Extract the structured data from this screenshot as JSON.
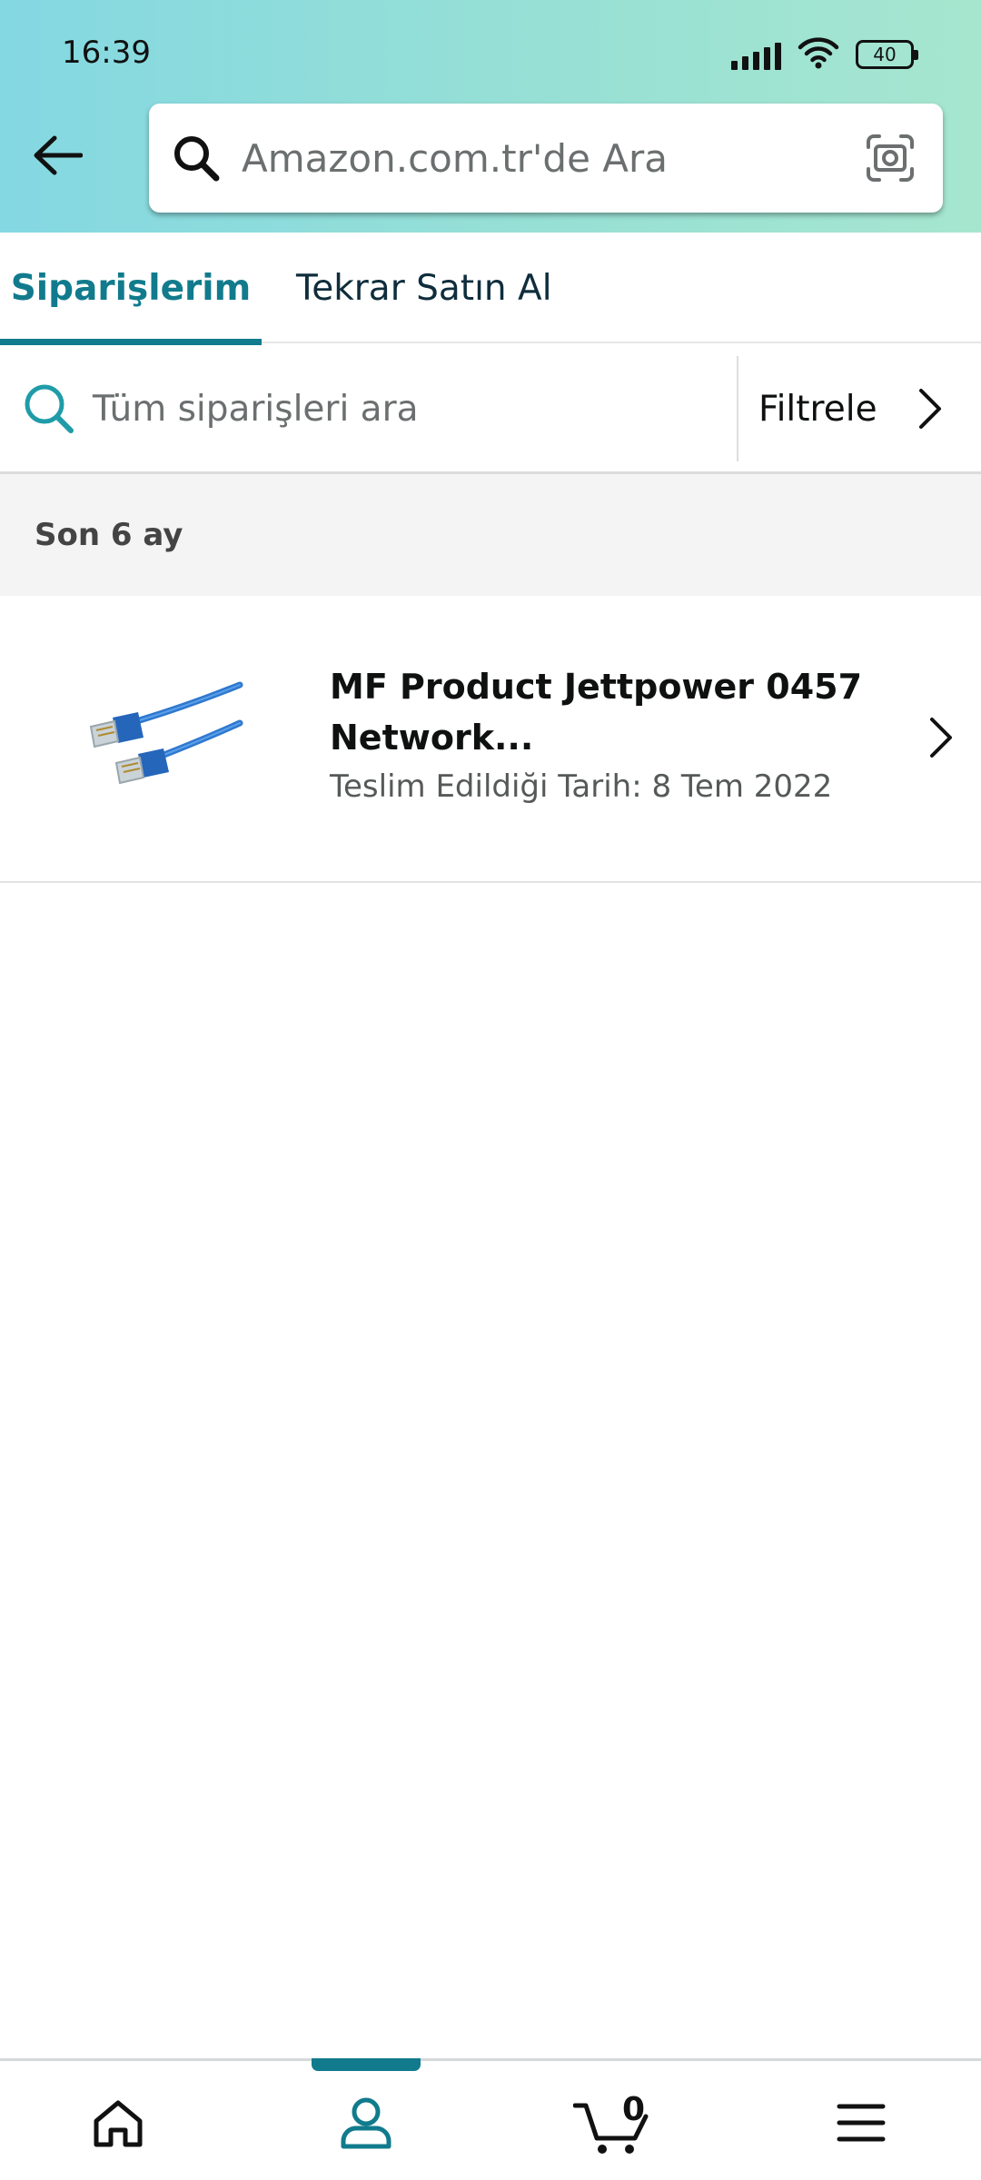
{
  "status_bar": {
    "time": "16:39",
    "battery": "40",
    "icons": [
      "signal-icon",
      "wifi-icon",
      "battery-icon"
    ]
  },
  "header": {
    "back_icon": "arrow-left-icon",
    "search_placeholder": "Amazon.com.tr'de Ara",
    "search_icon": "search-icon",
    "camera_icon": "camera-icon"
  },
  "tabs": [
    {
      "label": "Siparişlerim",
      "active": true
    },
    {
      "label": "Tekrar Satın Al",
      "active": false
    }
  ],
  "order_search": {
    "placeholder": "Tüm siparişleri ara",
    "filter_label": "Filtrele"
  },
  "section": {
    "label": "Son 6 ay"
  },
  "orders": [
    {
      "title": "MF Product Jettpower 0457 Network...",
      "delivery": "Teslim Edildiği Tarih: 8 Tem 2022",
      "image": "blue-network-cable"
    }
  ],
  "bottom_nav": {
    "items": [
      "home-icon",
      "account-icon",
      "cart-icon",
      "menu-icon"
    ],
    "active": "account-icon",
    "cart_count": "0"
  },
  "colors": {
    "accent": "#117b8d",
    "header_gradient_start": "#84d8e2",
    "header_gradient_end": "#a6e6cf",
    "section_bg": "#f4f4f4"
  }
}
